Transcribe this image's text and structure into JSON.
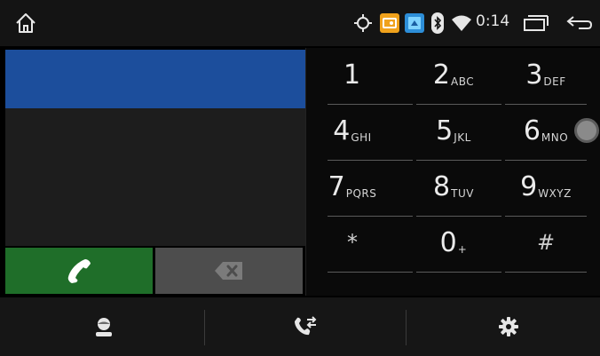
{
  "status_bar": {
    "time": "0:14",
    "icons": [
      "home-icon",
      "location-icon",
      "radio-app-icon",
      "media-app-icon",
      "bluetooth-icon",
      "wifi-icon",
      "recent-apps-icon",
      "back-icon"
    ]
  },
  "dialer": {
    "number": "",
    "keys": [
      {
        "digit": "1",
        "letters": ""
      },
      {
        "digit": "2",
        "letters": "ABC"
      },
      {
        "digit": "3",
        "letters": "DEF"
      },
      {
        "digit": "4",
        "letters": "GHI"
      },
      {
        "digit": "5",
        "letters": "JKL"
      },
      {
        "digit": "6",
        "letters": "MNO"
      },
      {
        "digit": "7",
        "letters": "PQRS"
      },
      {
        "digit": "8",
        "letters": "TUV"
      },
      {
        "digit": "9",
        "letters": "WXYZ"
      },
      {
        "digit": "*",
        "letters": ""
      },
      {
        "digit": "0",
        "letters": "+"
      },
      {
        "digit": "#",
        "letters": ""
      }
    ],
    "call_icon": "phone-icon",
    "delete_icon": "backspace-icon"
  },
  "bottom_nav": {
    "items": [
      "contacts-icon",
      "call-log-icon",
      "settings-icon"
    ]
  },
  "colors": {
    "display": "#1c4e9c",
    "call": "#1f6e29",
    "delete": "#4d4d4d"
  }
}
